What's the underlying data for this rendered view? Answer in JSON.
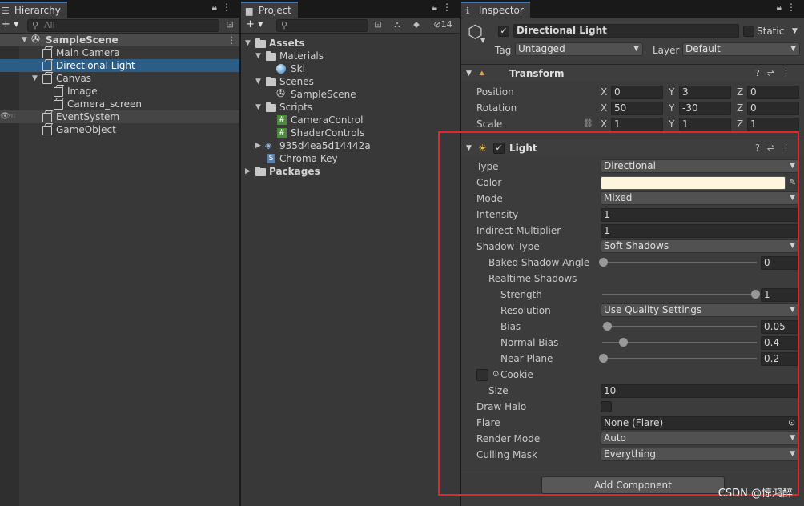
{
  "hierarchy": {
    "tab_label": "Hierarchy",
    "search_placeholder": "All",
    "scene": "SampleScene",
    "items": [
      {
        "label": "Main Camera"
      },
      {
        "label": "Directional Light"
      },
      {
        "label": "Canvas"
      },
      {
        "label": "Image"
      },
      {
        "label": "Camera_screen"
      },
      {
        "label": "EventSystem"
      },
      {
        "label": "GameObject"
      }
    ]
  },
  "project": {
    "tab_label": "Project",
    "hidden_count": "14",
    "tree": {
      "assets": "Assets",
      "materials": "Materials",
      "ski": "Ski",
      "scenes": "Scenes",
      "samplescene": "SampleScene",
      "scripts": "Scripts",
      "cameracontrol": "CameraControl",
      "shadercontrols": "ShaderControls",
      "hash_folder": "935d4ea5d14442a",
      "chroma_key": "Chroma Key",
      "packages": "Packages"
    }
  },
  "inspector": {
    "tab_label": "Inspector",
    "object_name": "Directional Light",
    "static_label": "Static",
    "tag_label": "Tag",
    "tag_value": "Untagged",
    "layer_label": "Layer",
    "layer_value": "Default",
    "transform": {
      "title": "Transform",
      "position_label": "Position",
      "rotation_label": "Rotation",
      "scale_label": "Scale",
      "axes": [
        "X",
        "Y",
        "Z"
      ],
      "position": [
        "0",
        "3",
        "0"
      ],
      "rotation": [
        "50",
        "-30",
        "0"
      ],
      "scale": [
        "1",
        "1",
        "1"
      ]
    },
    "light": {
      "title": "Light",
      "type_label": "Type",
      "type_value": "Directional",
      "color_label": "Color",
      "color_value": "#fff4dc",
      "mode_label": "Mode",
      "mode_value": "Mixed",
      "intensity_label": "Intensity",
      "intensity_value": "1",
      "indirect_label": "Indirect Multiplier",
      "indirect_value": "1",
      "shadow_type_label": "Shadow Type",
      "shadow_type_value": "Soft Shadows",
      "baked_angle_label": "Baked Shadow Angle",
      "baked_angle_value": "0",
      "realtime_label": "Realtime Shadows",
      "strength_label": "Strength",
      "strength_value": "1",
      "resolution_label": "Resolution",
      "resolution_value": "Use Quality Settings",
      "bias_label": "Bias",
      "bias_value": "0.05",
      "normal_bias_label": "Normal Bias",
      "normal_bias_value": "0.4",
      "near_plane_label": "Near Plane",
      "near_plane_value": "0.2",
      "cookie_label": "Cookie",
      "size_label": "Size",
      "size_value": "10",
      "draw_halo_label": "Draw Halo",
      "flare_label": "Flare",
      "flare_value": "None (Flare)",
      "render_mode_label": "Render Mode",
      "render_mode_value": "Auto",
      "culling_label": "Culling Mask",
      "culling_value": "Everything",
      "sliders": {
        "baked_angle": 0.0,
        "strength": 1.0,
        "bias": 0.025,
        "normal_bias": 0.13,
        "near_plane": 0.0
      }
    },
    "add_component_label": "Add Component"
  },
  "watermark": "CSDN @惊鸿醉"
}
